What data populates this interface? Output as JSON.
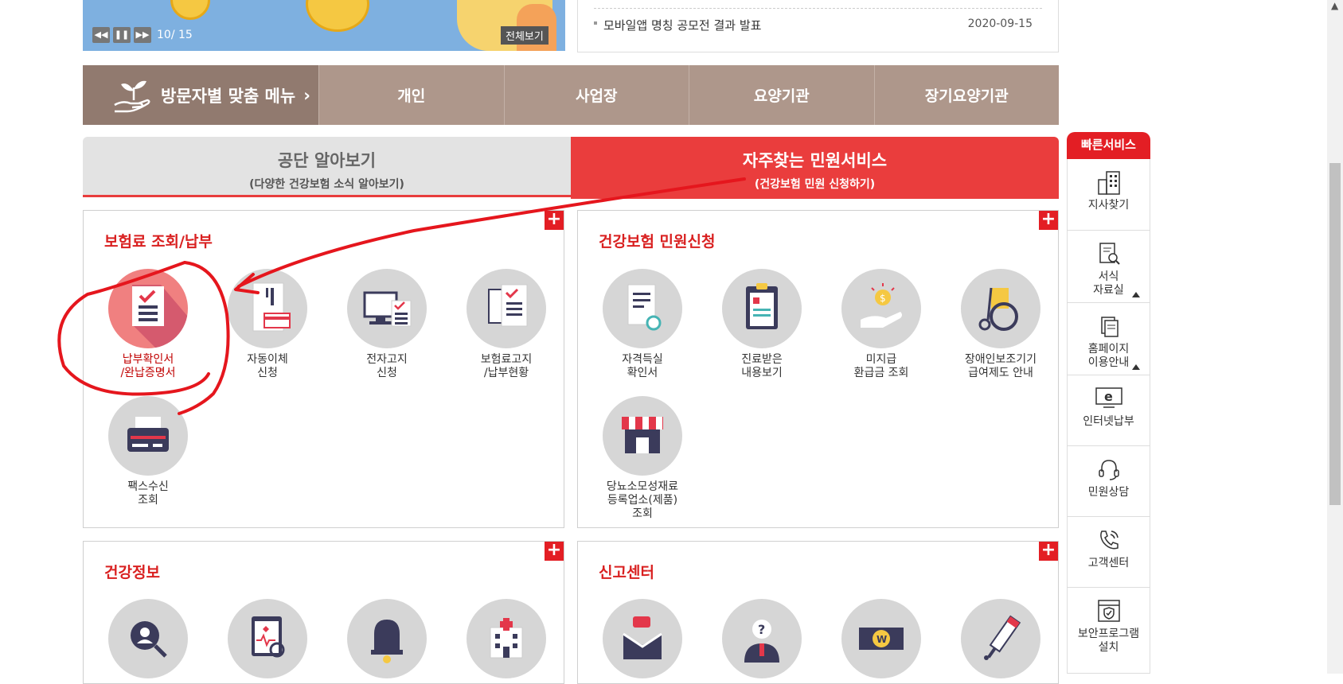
{
  "banner": {
    "counter": "10/ 15",
    "view_all": "전체보기"
  },
  "notice": {
    "title": "모바일앱 명칭 공모전 결과 발표",
    "date": "2020-09-15"
  },
  "visitor_menu": {
    "title": "방문자별 맞춤 메뉴",
    "tabs": [
      "개인",
      "사업장",
      "요양기관",
      "장기요양기관"
    ]
  },
  "tabs": {
    "info": {
      "main": "공단 알아보기",
      "sub": "(다양한 건강보험 소식 알아보기)"
    },
    "service": {
      "main": "자주찾는 민원서비스",
      "sub": "(건강보험 민원 신청하기)"
    }
  },
  "panels": {
    "premium": {
      "title": "보험료 조회/납부",
      "items": [
        "납부확인서\n/완납증명서",
        "자동이체\n신청",
        "전자고지\n신청",
        "보험료고지\n/납부현황",
        "팩스수신\n조회"
      ]
    },
    "civil": {
      "title": "건강보험 민원신청",
      "items": [
        "자격득실\n확인서",
        "진료받은\n내용보기",
        "미지급\n환급금 조회",
        "장애인보조기기\n급여제도 안내",
        "당뇨소모성재료\n등록업소(제품)\n조회"
      ]
    },
    "health": {
      "title": "건강정보"
    },
    "report": {
      "title": "신고센터"
    },
    "plus_label": "+"
  },
  "quick": {
    "title": "빠른서비스",
    "items": [
      "지사찾기",
      "서식\n자료실",
      "홈페이지\n이용안내",
      "인터넷납부",
      "민원상담",
      "고객센터",
      "보안프로그램\n설치"
    ]
  },
  "colors": {
    "accent": "#e31e24",
    "tab_red": "#ea3d3d",
    "visitor_bar": "#ae978b",
    "annotation": "#e5161d"
  }
}
